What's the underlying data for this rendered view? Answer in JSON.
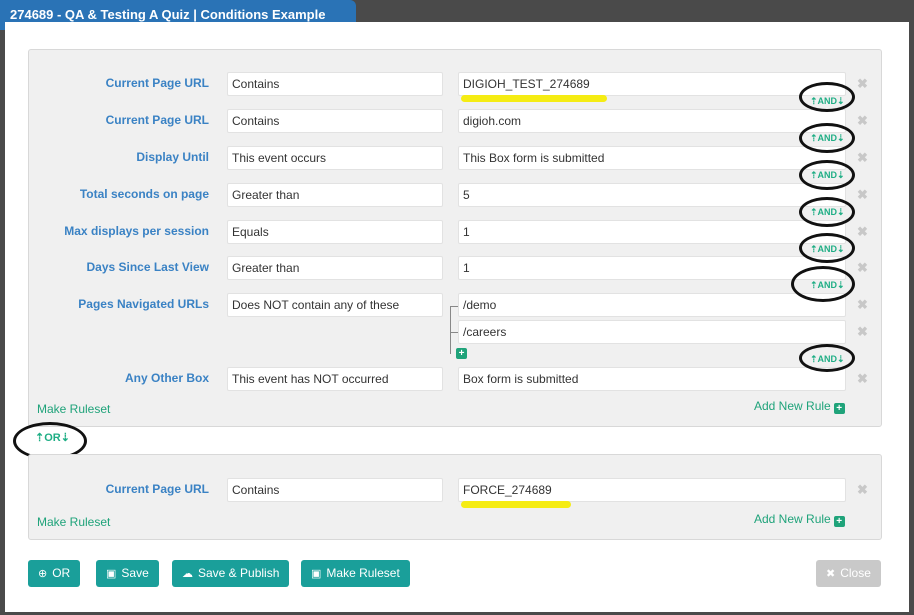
{
  "title": "274689 - QA & Testing A Quiz | Conditions Example",
  "ruleset1": {
    "rules": [
      {
        "label": "Current Page URL",
        "op": "Contains",
        "value": "DIGIOH_TEST_274689"
      },
      {
        "label": "Current Page URL",
        "op": "Contains",
        "value": "digioh.com"
      },
      {
        "label": "Display Until",
        "op": "This event occurs",
        "value": "This Box form is submitted"
      },
      {
        "label": "Total seconds on page",
        "op": "Greater than",
        "value": "5"
      },
      {
        "label": "Max displays per session",
        "op": "Equals",
        "value": "1"
      },
      {
        "label": "Days Since Last View",
        "op": "Greater than",
        "value": "1"
      },
      {
        "label": "Pages Navigated URLs",
        "op": "Does NOT contain any of these",
        "values": [
          "/demo",
          "/careers"
        ]
      },
      {
        "label": "Any Other Box",
        "op": "This event has NOT occurred",
        "value": "Box form is submitted"
      }
    ],
    "and_label": "AND",
    "make_ruleset": "Make Ruleset",
    "add_new_rule": "Add New Rule"
  },
  "or_label": "OR",
  "ruleset2": {
    "rules": [
      {
        "label": "Current Page URL",
        "op": "Contains",
        "value": "FORCE_274689"
      }
    ],
    "make_ruleset": "Make Ruleset",
    "add_new_rule": "Add New Rule"
  },
  "delete_symbol": "✖",
  "plus_symbol": "+",
  "footer": {
    "or": "OR",
    "save": "Save",
    "save_publish": "Save & Publish",
    "make_ruleset": "Make Ruleset",
    "close": "Close"
  },
  "icons": {
    "or": "plus-circle-icon",
    "save": "floppy-disk-icon",
    "save_publish": "cloud-upload-icon",
    "make_ruleset": "floppy-disk-icon",
    "close": "close-icon"
  },
  "colors": {
    "title_bar": "#2a73b6",
    "label_blue": "#3a82c4",
    "link_green": "#1fa37a",
    "button_teal": "#1a9f9a",
    "highlight_yellow": "#f5ec13"
  }
}
